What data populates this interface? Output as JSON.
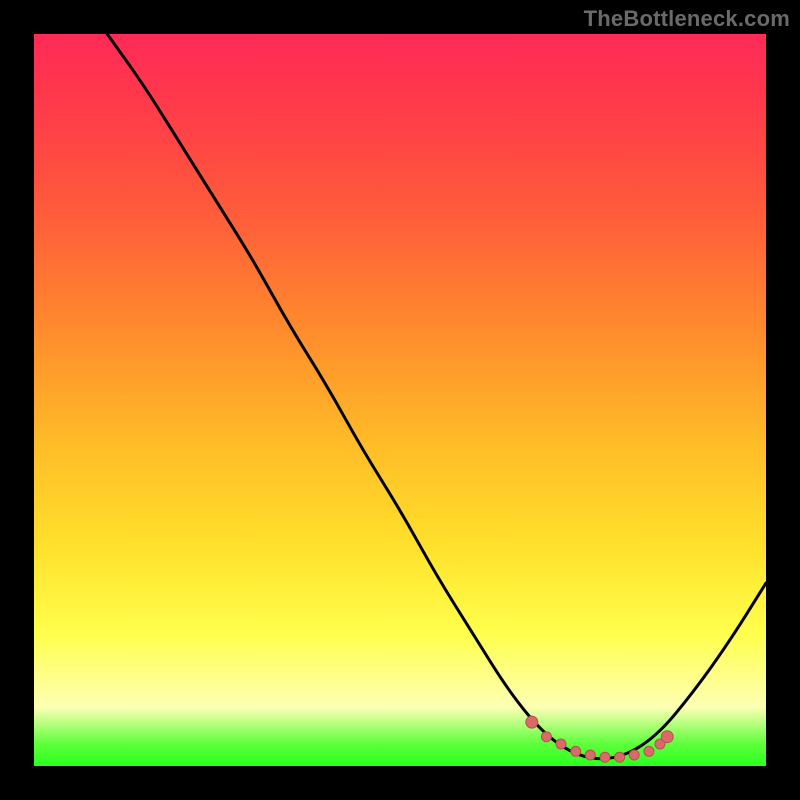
{
  "watermark": "TheBottleneck.com",
  "colors": {
    "frame": "#000000",
    "curve": "#000000",
    "marker_fill": "#d86a6a",
    "marker_stroke": "#b95050",
    "gradient_stops": [
      "#ff2a57",
      "#ff3b49",
      "#ff5d3a",
      "#ff8a2d",
      "#ffb928",
      "#ffe12b",
      "#ffff4d",
      "#fdffb4",
      "#5dff3a",
      "#2cff1f"
    ]
  },
  "chart_data": {
    "type": "line",
    "title": "",
    "xlabel": "",
    "ylabel": "",
    "xlim": [
      0,
      100
    ],
    "ylim": [
      0,
      100
    ],
    "grid": false,
    "legend": false,
    "curve": [
      {
        "x": 10,
        "y": 100
      },
      {
        "x": 15,
        "y": 93
      },
      {
        "x": 20,
        "y": 85
      },
      {
        "x": 25,
        "y": 77
      },
      {
        "x": 30,
        "y": 69
      },
      {
        "x": 35,
        "y": 60
      },
      {
        "x": 40,
        "y": 52
      },
      {
        "x": 45,
        "y": 43
      },
      {
        "x": 50,
        "y": 35
      },
      {
        "x": 55,
        "y": 26
      },
      {
        "x": 60,
        "y": 18
      },
      {
        "x": 65,
        "y": 10
      },
      {
        "x": 70,
        "y": 4
      },
      {
        "x": 75,
        "y": 1
      },
      {
        "x": 80,
        "y": 1
      },
      {
        "x": 85,
        "y": 4
      },
      {
        "x": 90,
        "y": 10
      },
      {
        "x": 95,
        "y": 17
      },
      {
        "x": 100,
        "y": 25
      }
    ],
    "markers": [
      {
        "x": 68,
        "y": 6
      },
      {
        "x": 70,
        "y": 4
      },
      {
        "x": 72,
        "y": 3
      },
      {
        "x": 74,
        "y": 2
      },
      {
        "x": 76,
        "y": 1.5
      },
      {
        "x": 78,
        "y": 1.2
      },
      {
        "x": 80,
        "y": 1.2
      },
      {
        "x": 82,
        "y": 1.5
      },
      {
        "x": 84,
        "y": 2
      },
      {
        "x": 85.5,
        "y": 3
      },
      {
        "x": 86.5,
        "y": 4
      }
    ]
  }
}
